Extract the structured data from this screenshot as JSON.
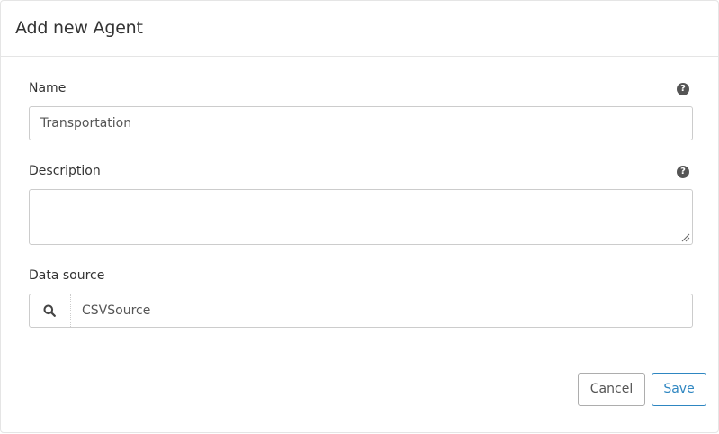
{
  "modal": {
    "title": "Add new Agent"
  },
  "form": {
    "name": {
      "label": "Name",
      "value": "Transportation",
      "help_icon": "question-circle-icon"
    },
    "description": {
      "label": "Description",
      "value": "",
      "help_icon": "question-circle-icon"
    },
    "data_source": {
      "label": "Data source",
      "value": "CSVSource",
      "icon": "search-icon"
    }
  },
  "footer": {
    "cancel_label": "Cancel",
    "save_label": "Save"
  },
  "colors": {
    "accent": "#2e86c1",
    "border": "#cccccc",
    "text": "#333333"
  }
}
